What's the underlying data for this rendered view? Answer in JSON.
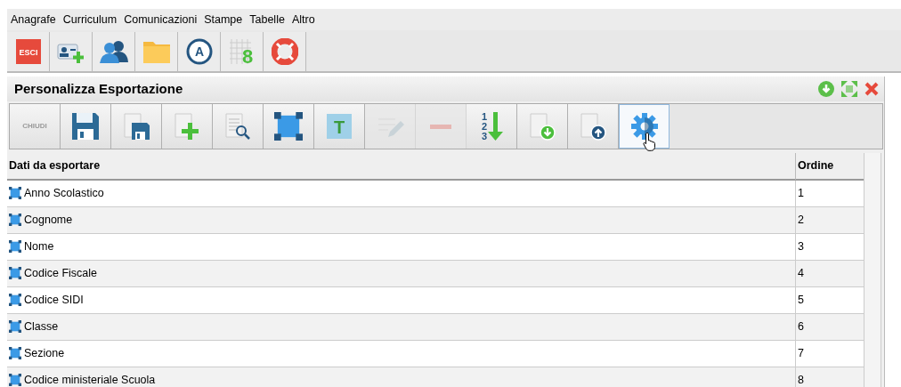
{
  "menu": [
    "Anagrafe",
    "Curriculum",
    "Comunicazioni",
    "Stampe",
    "Tabelle",
    "Altro"
  ],
  "main_toolbar": [
    {
      "kind": "exit",
      "label": "ESCI"
    },
    {
      "kind": "add-person"
    },
    {
      "kind": "people"
    },
    {
      "kind": "folder"
    },
    {
      "kind": "letter-a",
      "label": "A"
    },
    {
      "kind": "grid-eight",
      "label": "8"
    },
    {
      "kind": "lifebuoy"
    }
  ],
  "panel": {
    "title": "Personalizza Esportazione",
    "toolbar": [
      {
        "kind": "close-text",
        "label": "CHIUDI",
        "disabled": false,
        "hovered": false
      },
      {
        "kind": "save",
        "disabled": false,
        "hovered": false
      },
      {
        "kind": "save-small",
        "disabled": false,
        "hovered": false
      },
      {
        "kind": "new",
        "disabled": false,
        "hovered": false
      },
      {
        "kind": "preview",
        "disabled": false,
        "hovered": false
      },
      {
        "kind": "select",
        "disabled": false,
        "hovered": false
      },
      {
        "kind": "text",
        "label": "T",
        "disabled": false,
        "hovered": false
      },
      {
        "kind": "edit",
        "disabled": true,
        "hovered": false
      },
      {
        "kind": "delete",
        "disabled": true,
        "hovered": false
      },
      {
        "kind": "sort",
        "labels": [
          "1",
          "2",
          "3"
        ],
        "disabled": false,
        "hovered": false
      },
      {
        "kind": "doc-down",
        "disabled": false,
        "hovered": false
      },
      {
        "kind": "doc-up",
        "disabled": false,
        "hovered": false
      },
      {
        "kind": "gear",
        "disabled": false,
        "hovered": true
      }
    ],
    "table": {
      "columns": [
        "Dati da esportare",
        "Ordine"
      ],
      "rows": [
        [
          "Anno Scolastico",
          "1"
        ],
        [
          "Cognome",
          "2"
        ],
        [
          "Nome",
          "3"
        ],
        [
          "Codice Fiscale",
          "4"
        ],
        [
          "Codice SIDI",
          "5"
        ],
        [
          "Classe",
          "6"
        ],
        [
          "Sezione",
          "7"
        ],
        [
          "Codice ministeriale Scuola",
          "8"
        ]
      ]
    }
  }
}
